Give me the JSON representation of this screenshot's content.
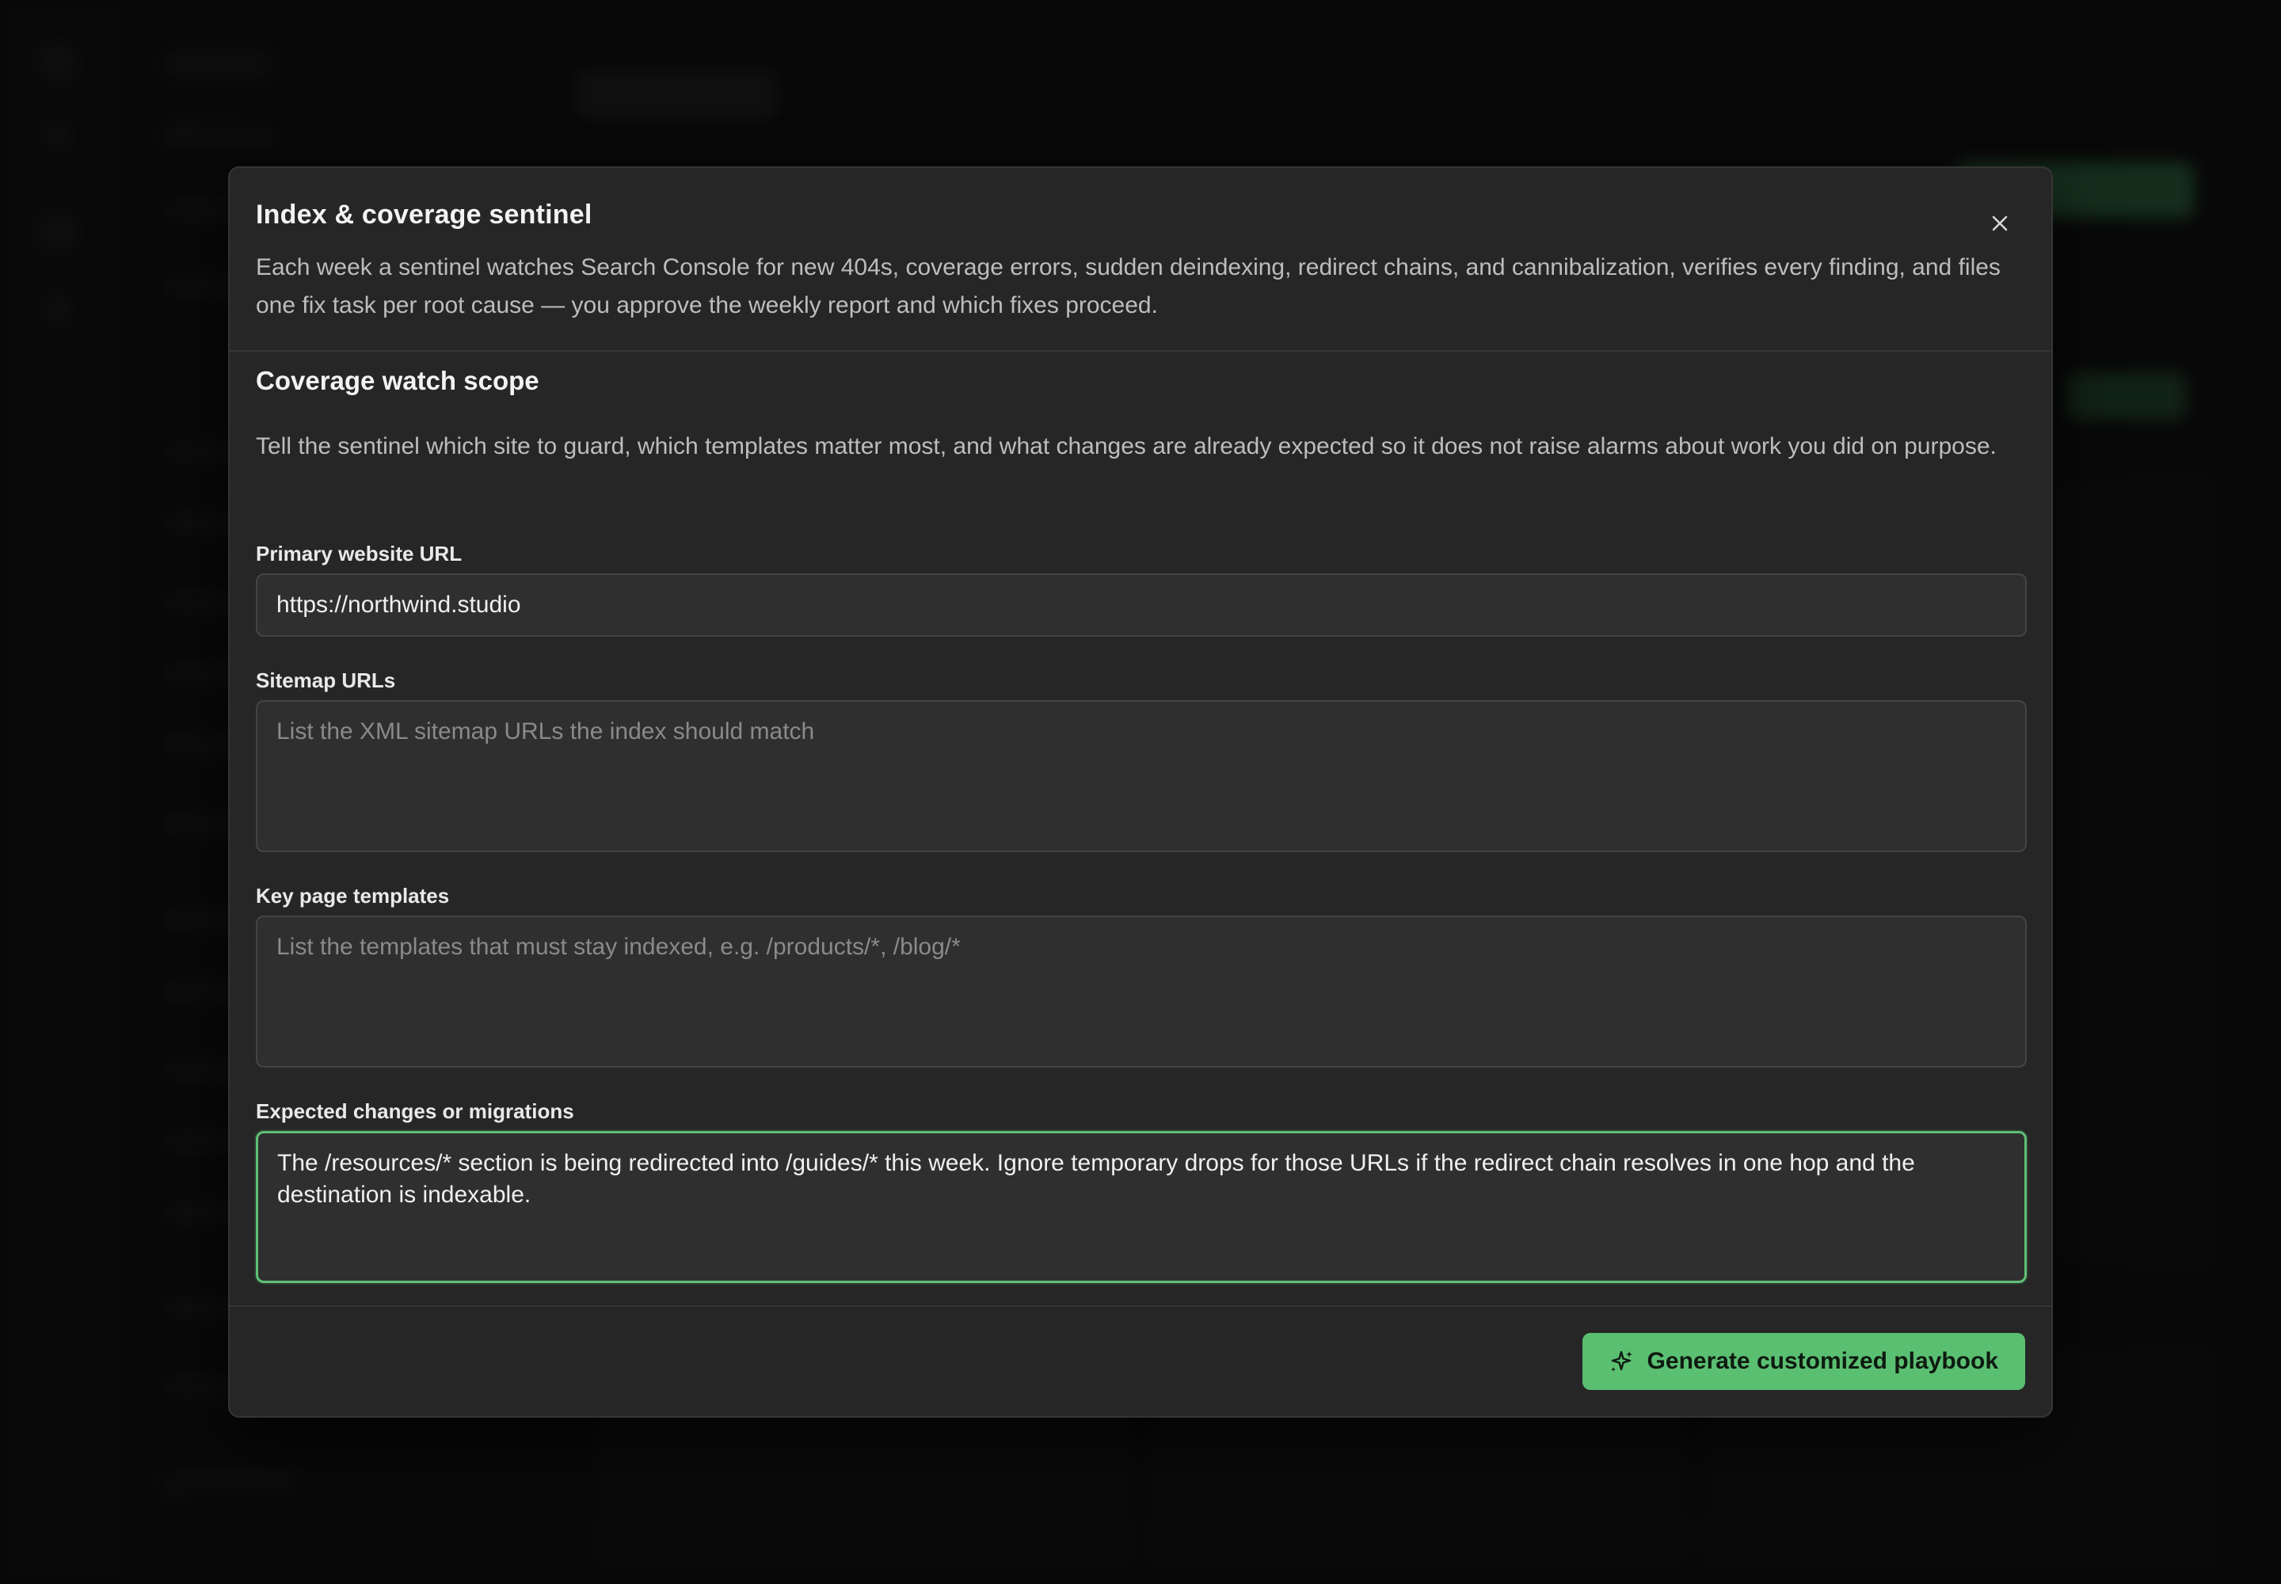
{
  "modal": {
    "title": "Index & coverage sentinel",
    "description": "Each week a sentinel watches Search Console for new 404s, coverage errors, sudden deindexing, redirect chains, and cannibalization, verifies every finding, and files one fix task per root cause — you approve the weekly report and which fixes proceed.",
    "close_icon": "close-icon"
  },
  "section": {
    "title": "Coverage watch scope",
    "description": "Tell the sentinel which site to guard, which templates matter most, and what changes are already expected so it does not raise alarms about work you did on purpose."
  },
  "fields": {
    "primary_url": {
      "label": "Primary website URL",
      "value": "https://northwind.studio"
    },
    "sitemaps": {
      "label": "Sitemap URLs",
      "placeholder": "List the XML sitemap URLs the index should match"
    },
    "templates": {
      "label": "Key page templates",
      "placeholder": "List the templates that must stay indexed, e.g. /products/*, /blog/*"
    },
    "expected_changes": {
      "label": "Expected changes or migrations",
      "value": "The /resources/* section is being redirected into /guides/* this week. Ignore temporary drops for those URLs if the redirect chain resolves in one hop and the destination is indexable."
    }
  },
  "footer": {
    "generate_label": "Generate customized playbook",
    "generate_icon": "sparkle-icon"
  },
  "colors": {
    "accent": "#5bbf72",
    "modal_bg": "#262626",
    "page_bg": "#0d0d0d"
  }
}
